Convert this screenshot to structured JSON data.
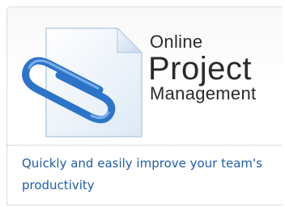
{
  "product": {
    "title_line1": "Online",
    "title_line2": "Project",
    "title_line3": "Management",
    "tagline": "Quickly and easily improve your team's productivity"
  },
  "icons": {
    "document": "document-icon",
    "paperclip": "paperclip-icon"
  },
  "colors": {
    "tagline": "#1f5ea8",
    "title": "#2a2a2a",
    "paperclip": "#2b74c9",
    "document": "#eef4fb"
  }
}
